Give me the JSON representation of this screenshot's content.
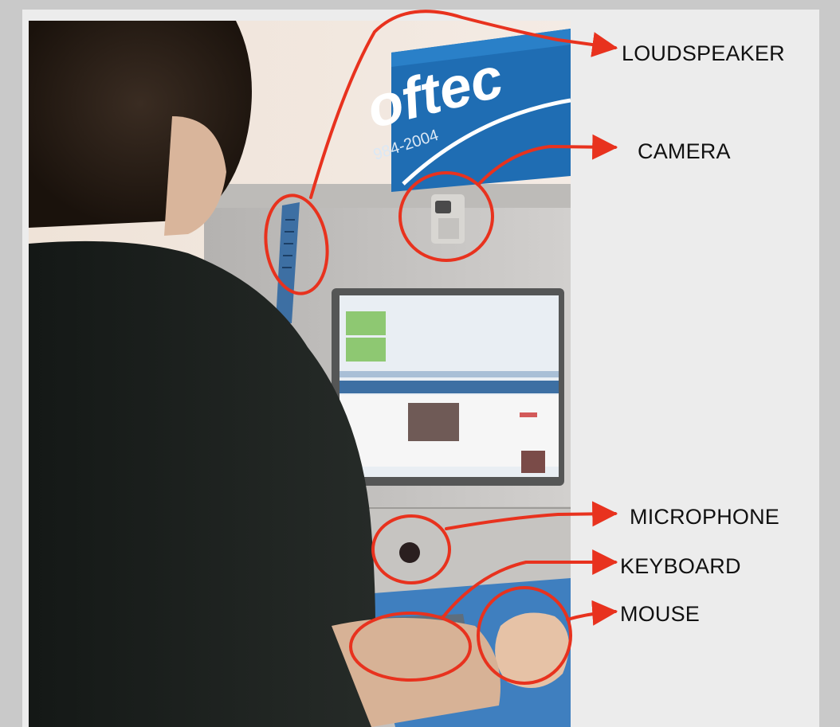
{
  "image": {
    "description_type": "annotated photo of internet kiosk",
    "sign_text": {
      "brand": "oftec",
      "years": "984-2004"
    }
  },
  "annotations": [
    {
      "id": "loudspeaker",
      "label": "LOUDSPEAKER"
    },
    {
      "id": "camera",
      "label": "CAMERA"
    },
    {
      "id": "microphone",
      "label": "MICROPHONE"
    },
    {
      "id": "keyboard",
      "label": "KEYBOARD"
    },
    {
      "id": "mouse",
      "label": "MOUSE"
    }
  ],
  "colors": {
    "annotation_red": "#e8321e",
    "frame_background": "#ececec",
    "sign_blue": "#1e6eb4"
  }
}
